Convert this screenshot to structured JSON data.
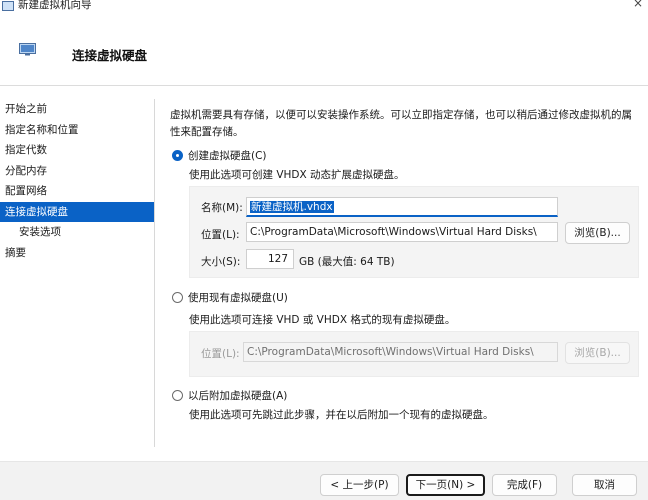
{
  "window": {
    "title": "新建虚拟机向导",
    "close_glyph": "×"
  },
  "header": {
    "title": "连接虚拟硬盘"
  },
  "sidebar": {
    "items": [
      {
        "label": "开始之前"
      },
      {
        "label": "指定名称和位置"
      },
      {
        "label": "指定代数"
      },
      {
        "label": "分配内存"
      },
      {
        "label": "配置网络"
      },
      {
        "label": "连接虚拟硬盘"
      },
      {
        "label": "安装选项"
      },
      {
        "label": "摘要"
      }
    ]
  },
  "main": {
    "intro": "虚拟机需要具有存储，以便可以安装操作系统。可以立即指定存储，也可以稍后通过修改虚拟机的属性来配置存储。",
    "option_create": {
      "label": "创建虚拟硬盘(C)",
      "desc": "使用此选项可创建 VHDX 动态扩展虚拟硬盘。",
      "checked": true,
      "name_label": "名称(M):",
      "name_value": "新建虚拟机.vhdx",
      "location_label": "位置(L):",
      "location_value": "C:\\ProgramData\\Microsoft\\Windows\\Virtual Hard Disks\\",
      "browse_label": "浏览(B)...",
      "size_label": "大小(S):",
      "size_value": "127",
      "size_unit": "GB (最大值: 64 TB)"
    },
    "option_existing": {
      "label": "使用现有虚拟硬盘(U)",
      "desc": "使用此选项可连接 VHD 或 VHDX 格式的现有虚拟硬盘。",
      "checked": false,
      "location_label": "位置(L):",
      "location_value": "C:\\ProgramData\\Microsoft\\Windows\\Virtual Hard Disks\\",
      "browse_label": "浏览(B)..."
    },
    "option_later": {
      "label": "以后附加虚拟硬盘(A)",
      "desc": "使用此选项可先跳过此步骤，并在以后附加一个现有的虚拟硬盘。",
      "checked": false
    }
  },
  "footer": {
    "prev_label": "< 上一步(P)",
    "next_label": "下一页(N) >",
    "finish_label": "完成(F)",
    "cancel_label": "取消"
  },
  "colors": {
    "accent": "#0a62c6",
    "selected_bg": "#0a62c6"
  }
}
